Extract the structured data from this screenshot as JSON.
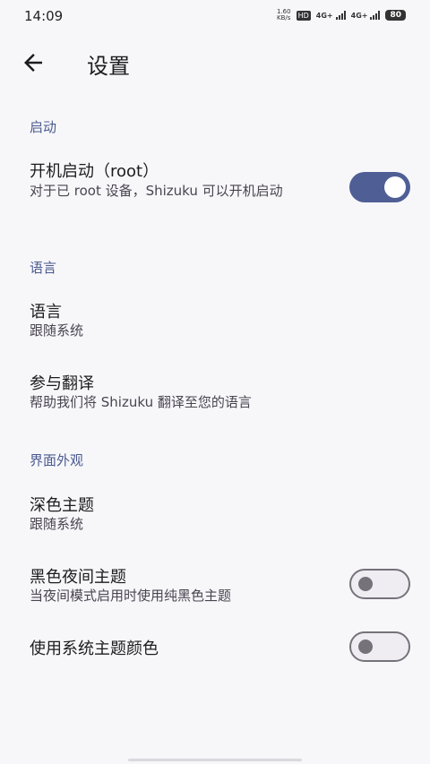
{
  "status_bar": {
    "time": "14:09",
    "speed_value": "1.60",
    "speed_unit": "KB/s",
    "hd": "HD",
    "sim1_type": "4G+",
    "sim2_type": "4G+",
    "battery": "80"
  },
  "app_bar": {
    "back_icon": "arrow-left-icon",
    "title": "设置"
  },
  "sections": {
    "startup": {
      "header": "启动",
      "boot_title": "开机启动（root）",
      "boot_summary": "对于已 root 设备，Shizuku 可以开机启动",
      "boot_toggle_on": true
    },
    "language": {
      "header": "语言",
      "language_title": "语言",
      "language_summary": "跟随系统",
      "translate_title": "参与翻译",
      "translate_summary": "帮助我们将 Shizuku 翻译至您的语言"
    },
    "appearance": {
      "header": "界面外观",
      "dark_title": "深色主题",
      "dark_summary": "跟随系统",
      "black_title": "黑色夜间主题",
      "black_summary": "当夜间模式启用时使用纯黑色主题",
      "black_toggle_on": false,
      "system_color_title": "使用系统主题颜色",
      "system_color_toggle_on": false
    }
  },
  "colors": {
    "accent": "#4f5f95",
    "section_header": "#4a5a8e",
    "background": "#f7f7fa"
  }
}
